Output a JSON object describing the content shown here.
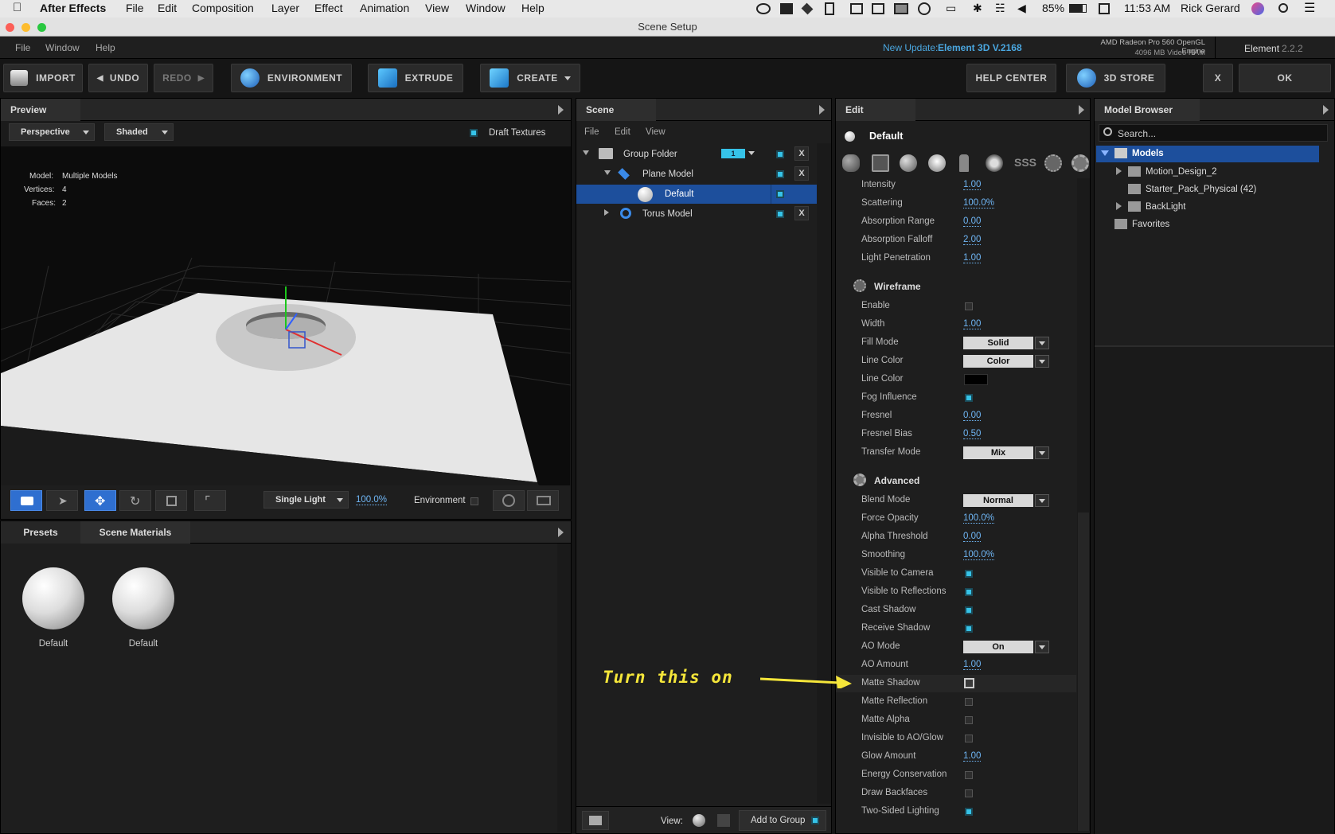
{
  "macos_menu": {
    "app": "After Effects",
    "items": [
      "File",
      "Edit",
      "Composition",
      "Layer",
      "Effect",
      "Animation",
      "View",
      "Window",
      "Help"
    ],
    "battery": "85%",
    "time": "11:53 AM",
    "user": "Rick Gerard"
  },
  "window": {
    "title": "Scene Setup",
    "menu": [
      "File",
      "Window",
      "Help"
    ],
    "update_prefix": "New Update:",
    "update_link": "Element 3D V.2168",
    "gpu_name": "AMD Radeon Pro 560 OpenGL Engine",
    "gpu_ram": "4096 MB Video RAM",
    "plugin_name": "Element",
    "plugin_version": "2.2.2"
  },
  "toolbar": {
    "import": "IMPORT",
    "undo": "UNDO",
    "redo": "REDO",
    "environment": "ENVIRONMENT",
    "extrude": "EXTRUDE",
    "create": "CREATE",
    "help_center": "HELP CENTER",
    "store": "3D STORE",
    "close": "X",
    "ok": "OK"
  },
  "preview": {
    "tab": "Preview",
    "view_mode": "Perspective",
    "shading": "Shaded",
    "draft_textures": "Draft Textures",
    "stats": {
      "model_label": "Model:",
      "model_value": "Multiple Models",
      "vertices_label": "Vertices:",
      "vertices_value": "4",
      "faces_label": "Faces:",
      "faces_value": "2"
    },
    "light_mode": "Single Light",
    "light_amount": "100.0%",
    "environment_label": "Environment"
  },
  "materials": {
    "tabs": [
      "Presets",
      "Scene Materials"
    ],
    "items": [
      "Default",
      "Default"
    ]
  },
  "scene": {
    "tab": "Scene",
    "menu": [
      "File",
      "Edit",
      "View"
    ],
    "tree": [
      {
        "label": "Group Folder",
        "badge": "1",
        "close": "X"
      },
      {
        "label": "Plane Model",
        "close": "X"
      },
      {
        "label": "Default"
      },
      {
        "label": "Torus Model",
        "close": "X"
      }
    ],
    "view_label": "View:",
    "add_to_group": "Add to Group"
  },
  "edit": {
    "tab": "Edit",
    "material_name": "Default",
    "props_top": [
      {
        "label": "Intensity",
        "value": "1.00"
      },
      {
        "label": "Scattering",
        "value": "100.0%"
      },
      {
        "label": "Absorption Range",
        "value": "0.00"
      },
      {
        "label": "Absorption Falloff",
        "value": "2.00"
      },
      {
        "label": "Light Penetration",
        "value": "1.00"
      }
    ],
    "wireframe_title": "Wireframe",
    "wireframe": {
      "enable": "Enable",
      "width": "Width",
      "width_val": "1.00",
      "fill_mode": "Fill Mode",
      "fill_mode_val": "Solid",
      "line_color1": "Line Color",
      "line_color1_val": "Color",
      "line_color2": "Line Color",
      "fog": "Fog Influence",
      "fresnel": "Fresnel",
      "fresnel_val": "0.00",
      "fresnel_bias": "Fresnel Bias",
      "fresnel_bias_val": "0.50",
      "transfer": "Transfer Mode",
      "transfer_val": "Mix"
    },
    "advanced_title": "Advanced",
    "advanced": {
      "blend": "Blend Mode",
      "blend_val": "Normal",
      "force_opacity": "Force Opacity",
      "force_opacity_val": "100.0%",
      "alpha_threshold": "Alpha Threshold",
      "alpha_threshold_val": "0.00",
      "smoothing": "Smoothing",
      "smoothing_val": "100.0%",
      "vis_camera": "Visible to Camera",
      "vis_reflections": "Visible to Reflections",
      "cast_shadow": "Cast Shadow",
      "receive_shadow": "Receive Shadow",
      "ao_mode": "AO Mode",
      "ao_mode_val": "On",
      "ao_amount": "AO Amount",
      "ao_amount_val": "1.00",
      "matte_shadow": "Matte Shadow",
      "matte_reflection": "Matte Reflection",
      "matte_alpha": "Matte Alpha",
      "invisible_ao": "Invisible to AO/Glow",
      "glow_amount": "Glow Amount",
      "glow_amount_val": "1.00",
      "energy": "Energy Conservation",
      "backfaces": "Draw Backfaces",
      "two_sided": "Two-Sided Lighting"
    }
  },
  "browser": {
    "tab": "Model Browser",
    "search_placeholder": "Search...",
    "tree": [
      "Models",
      "Motion_Design_2",
      "Starter_Pack_Physical (42)",
      "BackLight",
      "Favorites"
    ]
  },
  "annotation": "Turn this on",
  "colors": {
    "accent": "#36c3e8",
    "selection": "#1d4f9c",
    "link": "#6fb6f5",
    "annotation": "#f5e63a"
  }
}
